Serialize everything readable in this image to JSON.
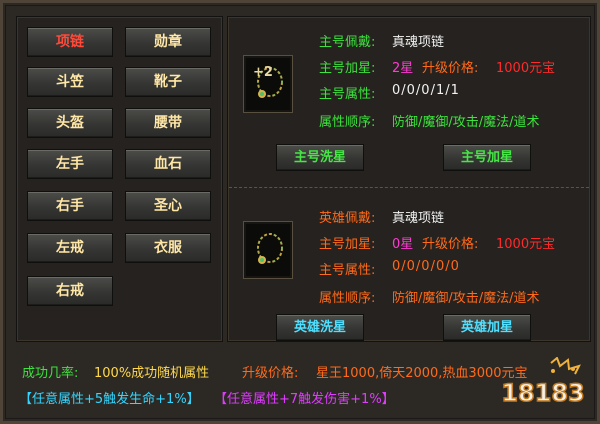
{
  "slots": [
    {
      "label": "项链",
      "active": true
    },
    {
      "label": "勋章",
      "active": false
    },
    {
      "label": "斗笠",
      "active": false
    },
    {
      "label": "靴子",
      "active": false
    },
    {
      "label": "头盔",
      "active": false
    },
    {
      "label": "腰带",
      "active": false
    },
    {
      "label": "左手",
      "active": false
    },
    {
      "label": "血石",
      "active": false
    },
    {
      "label": "右手",
      "active": false
    },
    {
      "label": "圣心",
      "active": false
    },
    {
      "label": "左戒",
      "active": false
    },
    {
      "label": "衣服",
      "active": false
    },
    {
      "label": "右戒",
      "active": false
    }
  ],
  "main": {
    "equip_label": "主号佩戴:",
    "equip_value": "真魂项链",
    "star_label": "主号加星:",
    "star_value": "2星",
    "price_label": "升级价格:",
    "price_value": "1000元宝",
    "attr_label": "主号属性:",
    "attr_value": "0/0/0/1/1",
    "order_label": "属性顺序:",
    "order_value": "防御/魔御/攻击/魔法/道术",
    "icon_badge": "+2",
    "wash_button": "主号洗星",
    "add_button": "主号加星"
  },
  "hero": {
    "equip_label": "英雄佩戴:",
    "equip_value": "真魂项链",
    "star_label": "主号加星:",
    "star_value": "0星",
    "price_label": "升级价格:",
    "price_value": "1000元宝",
    "attr_label": "主号属性:",
    "attr_value": "0/0/0/0/0",
    "order_label": "属性顺序:",
    "order_value": "防御/魔御/攻击/魔法/道术",
    "wash_button": "英雄洗星",
    "add_button": "英雄加星"
  },
  "footer": {
    "rate_label": "成功几率:",
    "rate_value": "100%成功随机属性",
    "upgrade_label": "升级价格:",
    "upgrade_value": "星王1000,倚天2000,热血3000元宝",
    "bonus1": "【任意属性+5触发生命+1%】",
    "bonus2": "【任意属性+7触发伤害+1%】"
  },
  "logo_text": "18183",
  "colors": {
    "label_green": "#3ce33c",
    "value_red": "#ff2a2a",
    "star_pink": "#ff3bd4",
    "price_orange": "#ff6a1a",
    "slot_gold": "#ffe7a6",
    "slot_active_red": "#ff4a3a"
  }
}
